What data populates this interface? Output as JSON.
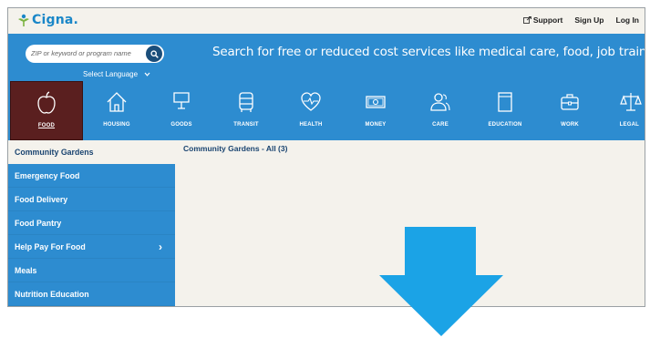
{
  "header": {
    "logo_text": "Cigna.",
    "links": {
      "support": "Support",
      "signup": "Sign Up",
      "login": "Log In"
    }
  },
  "search": {
    "placeholder": "ZIP or keyword or program name",
    "language_label": "Select Language",
    "tagline": "Search for free or reduced cost services like medical care, food, job training, and more."
  },
  "categories": [
    {
      "label": "FOOD",
      "icon": "apple-icon",
      "active": true
    },
    {
      "label": "HOUSING",
      "icon": "house-icon"
    },
    {
      "label": "GOODS",
      "icon": "lamp-icon"
    },
    {
      "label": "TRANSIT",
      "icon": "bus-icon"
    },
    {
      "label": "HEALTH",
      "icon": "heart-pulse-icon"
    },
    {
      "label": "MONEY",
      "icon": "banknote-icon"
    },
    {
      "label": "CARE",
      "icon": "people-icon"
    },
    {
      "label": "EDUCATION",
      "icon": "book-icon"
    },
    {
      "label": "WORK",
      "icon": "briefcase-icon"
    },
    {
      "label": "LEGAL",
      "icon": "scales-icon"
    }
  ],
  "sidebar": {
    "items": [
      {
        "label": "Community Gardens",
        "active": true
      },
      {
        "label": "Emergency Food"
      },
      {
        "label": "Food Delivery"
      },
      {
        "label": "Food Pantry"
      },
      {
        "label": "Help Pay For Food",
        "has_submenu": true
      },
      {
        "label": "Meals"
      },
      {
        "label": "Nutrition Education"
      }
    ]
  },
  "main": {
    "title": "Community Gardens - All (3)"
  },
  "colors": {
    "brand_blue": "#2d8cd0",
    "active_category": "#5a1f1f",
    "arrow": "#1ba3e6",
    "logo_green": "#7cb342"
  }
}
